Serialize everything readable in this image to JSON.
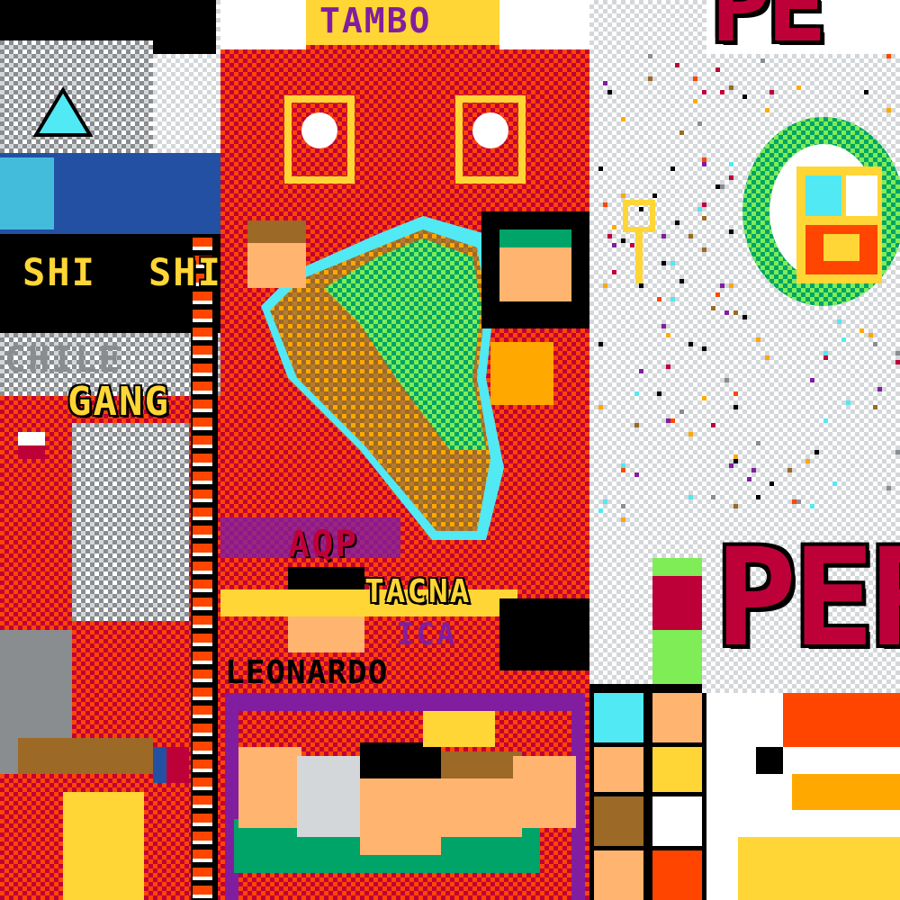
{
  "canvas": {
    "colors": {
      "red": "#be0039",
      "orange_red": "#ff4500",
      "orange": "#ffa800",
      "yellow": "#ffd635",
      "green": "#00a368",
      "light_green": "#7eed56",
      "blue": "#2450a4",
      "light_blue": "#51e9f4",
      "purple": "#811e9f",
      "brown": "#9c6926",
      "skin": "#ffb470",
      "black": "#000000",
      "gray": "#898d90",
      "light_gray": "#d4d7d9",
      "white": "#ffffff"
    }
  },
  "labels": {
    "tambo": "TAMBO",
    "shi_left": "SHI",
    "shi_right": "SHI",
    "gang": "GANG",
    "chile": "CHILE",
    "aqp": "AQP",
    "tacna": "TACNA",
    "ica": "ICA",
    "leonardo": "LEONARDO",
    "peru_bottom": "PER",
    "peru_top": "PE"
  }
}
